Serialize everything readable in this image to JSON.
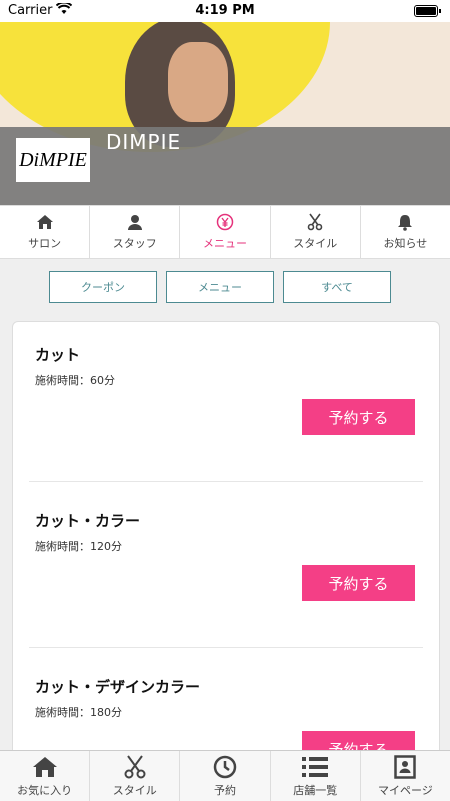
{
  "status_bar": {
    "carrier": "Carrier",
    "time": "4:19 PM"
  },
  "salon": {
    "logo_text": "DiMPIE",
    "name": "DIMPIE"
  },
  "tabs": [
    {
      "label": "サロン",
      "icon": "home-icon"
    },
    {
      "label": "スタッフ",
      "icon": "person-icon"
    },
    {
      "label": "メニュー",
      "icon": "yen-icon",
      "active": true
    },
    {
      "label": "スタイル",
      "icon": "scissors-icon"
    },
    {
      "label": "お知らせ",
      "icon": "bell-icon"
    }
  ],
  "filters": [
    "クーポン",
    "メニュー",
    "すべて"
  ],
  "menu_items": [
    {
      "name": "カット",
      "time": "施術時間：60分",
      "button": "予約する"
    },
    {
      "name": "カット・カラー",
      "time": "施術時間：120分",
      "button": "予約する"
    },
    {
      "name": "カット・デザインカラー",
      "time": "施術時間：180分",
      "button": "予約する"
    }
  ],
  "bottom_nav": [
    {
      "label": "お気に入り",
      "icon": "home-icon"
    },
    {
      "label": "スタイル",
      "icon": "scissors-icon"
    },
    {
      "label": "予約",
      "icon": "clock-icon"
    },
    {
      "label": "店舗一覧",
      "icon": "list-icon"
    },
    {
      "label": "マイページ",
      "icon": "profile-card-icon"
    }
  ],
  "colors": {
    "accent": "#e5327b",
    "book_button": "#f43f86",
    "filter_border": "#4c8a91"
  }
}
